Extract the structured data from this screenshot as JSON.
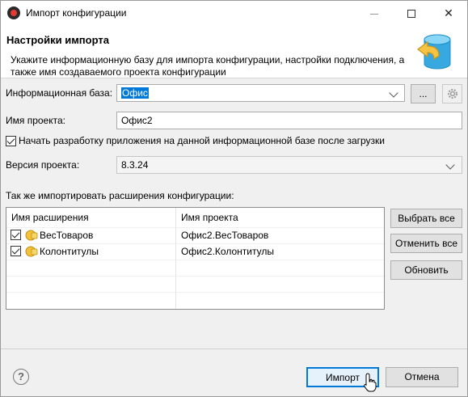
{
  "window": {
    "title": "Импорт конфигурации"
  },
  "header": {
    "title": "Настройки импорта",
    "description": "Укажите информационную базу для импорта конфигурации, настройки подключения, а также имя создаваемого проекта конфигурации"
  },
  "form": {
    "infobase_label": "Информационная база:",
    "infobase_value": "Офис",
    "browse_label": "...",
    "project_name_label": "Имя проекта:",
    "project_name_value": "Офис2",
    "start_dev_label": "Начать разработку приложения на данной информационной базе после загрузки",
    "start_dev_checked": true,
    "version_label": "Версия проекта:",
    "version_value": "8.3.24"
  },
  "extensions": {
    "section_label": "Так же импортировать расширения конфигурации:",
    "columns": [
      "Имя расширения",
      "Имя проекта"
    ],
    "rows": [
      {
        "name": "ВесТоваров",
        "project": "Офис2.ВесТоваров",
        "checked": true
      },
      {
        "name": "Колонтитулы",
        "project": "Офис2.Колонтитулы",
        "checked": true
      }
    ],
    "select_all_label": "Выбрать все",
    "deselect_all_label": "Отменить все",
    "refresh_label": "Обновить"
  },
  "footer": {
    "help": "?",
    "import_label": "Импорт",
    "cancel_label": "Отмена"
  },
  "colors": {
    "selection": "#0078d7",
    "default_button_border": "#0078d7"
  }
}
